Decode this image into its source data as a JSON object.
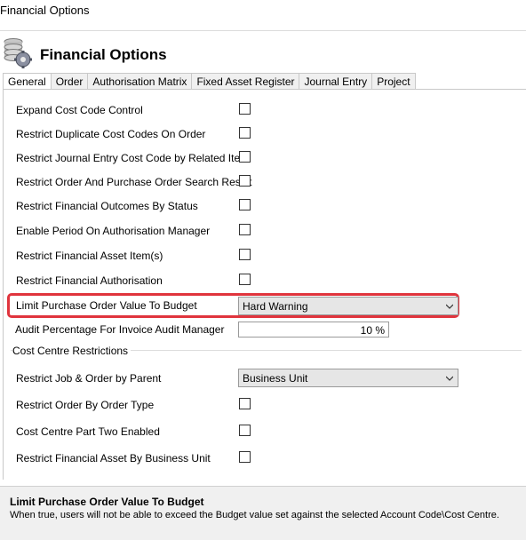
{
  "window": {
    "title": "Financial Options"
  },
  "header": {
    "title": "Financial Options",
    "icon": "coins-gear-icon"
  },
  "tabs": [
    {
      "label": "General",
      "active": true
    },
    {
      "label": "Order",
      "active": false
    },
    {
      "label": "Authorisation Matrix",
      "active": false
    },
    {
      "label": "Fixed Asset Register",
      "active": false
    },
    {
      "label": "Journal Entry",
      "active": false
    },
    {
      "label": "Project",
      "active": false
    }
  ],
  "general": {
    "options": [
      {
        "label": "Expand Cost Code Control",
        "checked": false
      },
      {
        "label": "Restrict Duplicate Cost Codes On Order",
        "checked": false
      },
      {
        "label": "Restrict Journal Entry Cost Code by Related Item",
        "checked": false
      },
      {
        "label": "Restrict Order And Purchase Order Search Result",
        "checked": false
      },
      {
        "label": "Restrict Financial Outcomes By Status",
        "checked": false
      },
      {
        "label": "Enable Period On Authorisation Manager",
        "checked": false
      },
      {
        "label": "Restrict Financial Asset Item(s)",
        "checked": false
      },
      {
        "label": "Restrict Financial Authorisation",
        "checked": false
      }
    ],
    "limit_po": {
      "label": "Limit Purchase Order Value To Budget",
      "value": "Hard Warning"
    },
    "audit_pct": {
      "label": "Audit Percentage For Invoice Audit Manager",
      "value": "10 %"
    }
  },
  "cost_centre": {
    "group_label": "Cost Centre Restrictions",
    "job_order": {
      "label": "Restrict Job & Order by Parent",
      "value": "Business Unit"
    },
    "options": [
      {
        "label": "Restrict Order By Order Type",
        "checked": false
      },
      {
        "label": "Cost Centre Part Two Enabled",
        "checked": false
      },
      {
        "label": "Restrict Financial Asset By Business Unit",
        "checked": false
      }
    ]
  },
  "help": {
    "title": "Limit Purchase Order Value To Budget",
    "description": "When true, users will not be able to exceed the Budget value set against the selected Account Code\\Cost Centre."
  },
  "colors": {
    "highlight": "#e0343d",
    "tab_bg": "#f0f0f0",
    "help_bg": "#f0f0f0"
  }
}
